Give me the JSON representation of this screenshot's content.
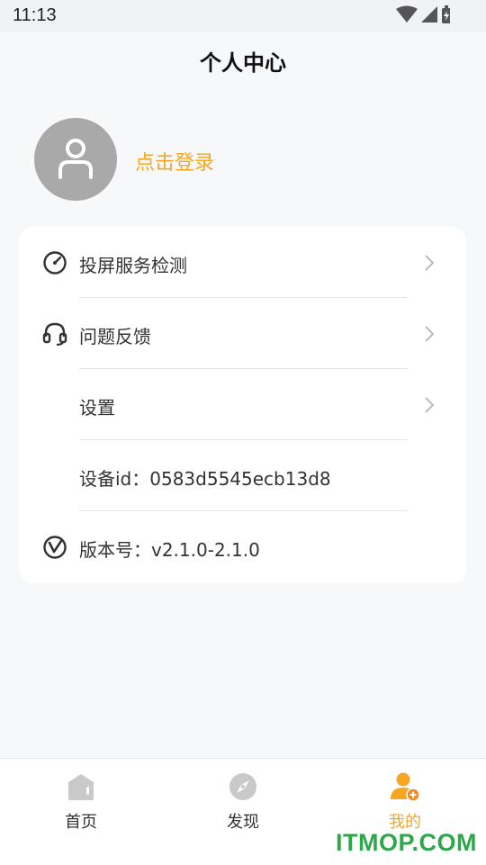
{
  "status_bar": {
    "time": "11:13",
    "icons": [
      "wifi-icon",
      "signal-icon",
      "battery-icon"
    ]
  },
  "header": {
    "title": "个人中心"
  },
  "profile": {
    "login_label": "点击登录",
    "avatar_icon": "user-icon"
  },
  "menu": {
    "items": [
      {
        "label": "投屏服务检测",
        "icon": "gauge-icon",
        "has_chevron": true
      },
      {
        "label": "问题反馈",
        "icon": "headset-icon",
        "has_chevron": true
      },
      {
        "label": "设置",
        "icon": "",
        "has_chevron": true
      },
      {
        "label": "设备id：0583d5545ecb13d8",
        "icon": "",
        "has_chevron": false
      },
      {
        "label": "版本号：v2.1.0-2.1.0",
        "icon": "version-icon",
        "has_chevron": false
      }
    ]
  },
  "bottom_nav": {
    "tabs": [
      {
        "label": "首页",
        "icon": "home-icon",
        "active": false
      },
      {
        "label": "发现",
        "icon": "compass-icon",
        "active": false
      },
      {
        "label": "我的",
        "icon": "profile-icon",
        "active": true
      }
    ]
  },
  "watermark": "ITMOP.COM",
  "colors": {
    "accent": "#f5a623",
    "background": "#f7f8fa",
    "watermark": "#2ca84a"
  }
}
